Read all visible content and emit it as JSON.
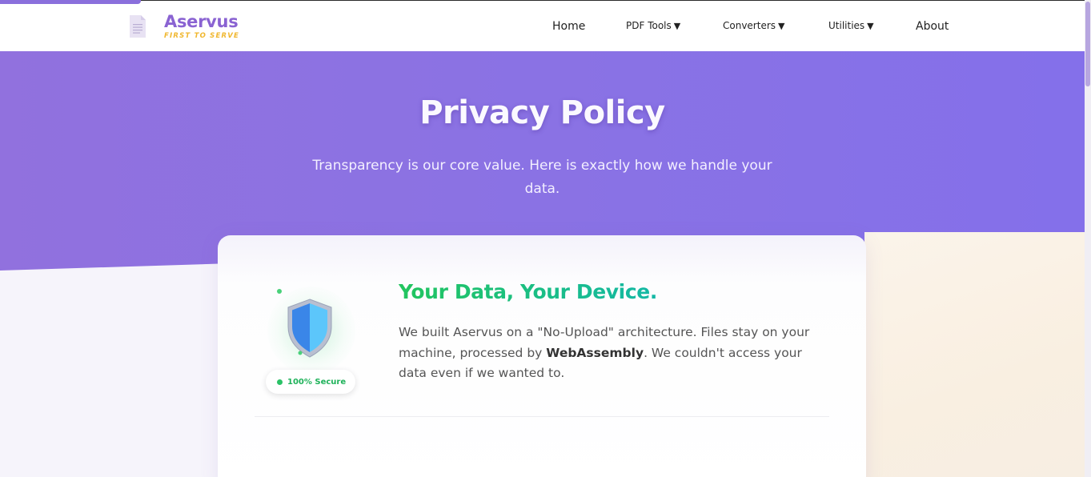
{
  "brand": {
    "name": "Aservus",
    "tagline": "FIRST TO SERVE",
    "icon": "document-icon"
  },
  "nav": {
    "home": "Home",
    "pdf_tools": "PDF Tools",
    "converters": "Converters",
    "utilities": "Utilities",
    "about": "About",
    "caret": "▼"
  },
  "hero": {
    "title": "Privacy Policy",
    "subtitle": "Transparency is our core value. Here is exactly how we handle your data."
  },
  "card": {
    "title": "Your Data, Your Device.",
    "body_part1": "We built Aservus on a \"No-Upload\" architecture. Files stay on your machine, processed by ",
    "body_bold": "WebAssembly",
    "body_part2": ". We couldn't access your data even if we wanted to.",
    "badge": "100% Secure",
    "icon": "shield-icon"
  },
  "colors": {
    "brand": "#8a63d2",
    "tagline": "#f0b72f",
    "hero": "#8a72e4",
    "title_gradient_start": "#22c55e",
    "title_gradient_end": "#14b8a6",
    "badge": "#1fb25a"
  }
}
